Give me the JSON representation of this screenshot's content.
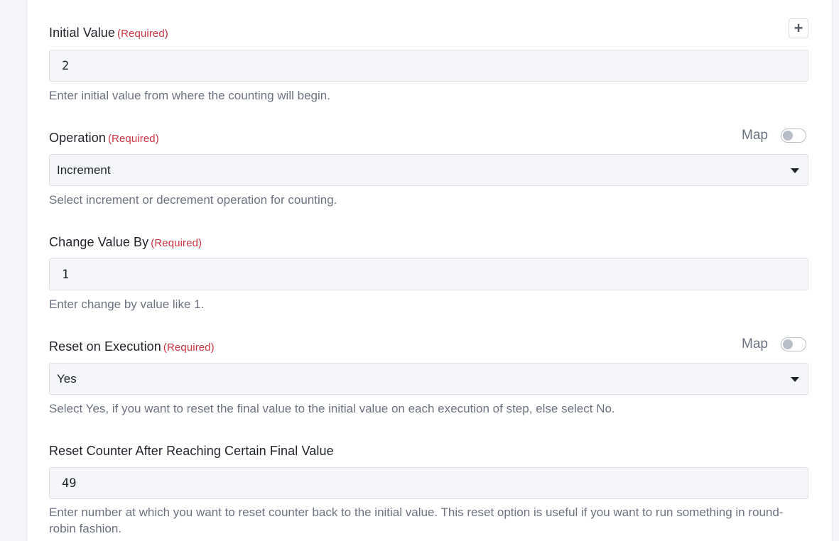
{
  "required_tag": "(Required)",
  "map_label": "Map",
  "fields": [
    {
      "label": "Initial Value",
      "required": true,
      "value": "2",
      "help": "Enter initial value from where the counting will begin."
    },
    {
      "label": "Operation",
      "required": true,
      "selected": "Increment",
      "help": "Select increment or decrement operation for counting.",
      "map_enabled": false
    },
    {
      "label": "Change Value By",
      "required": true,
      "value": "1",
      "help": "Enter change by value like 1."
    },
    {
      "label": "Reset on Execution",
      "required": true,
      "selected": "Yes",
      "help": "Select Yes, if you want to reset the final value to the initial value on each execution of step, else select No.",
      "map_enabled": false
    },
    {
      "label": "Reset Counter After Reaching Certain Final Value",
      "required": false,
      "value": "49",
      "help": "Enter number at which you want to reset counter back to the initial value. This reset option is useful if you want to run something in round-robin fashion."
    }
  ],
  "icons": {
    "add": "plus-icon",
    "dropdown": "caret-down-icon"
  },
  "colors": {
    "required": "#cc3340",
    "input_bg": "#f4f6f9",
    "page_bg": "#f3f5f8"
  }
}
